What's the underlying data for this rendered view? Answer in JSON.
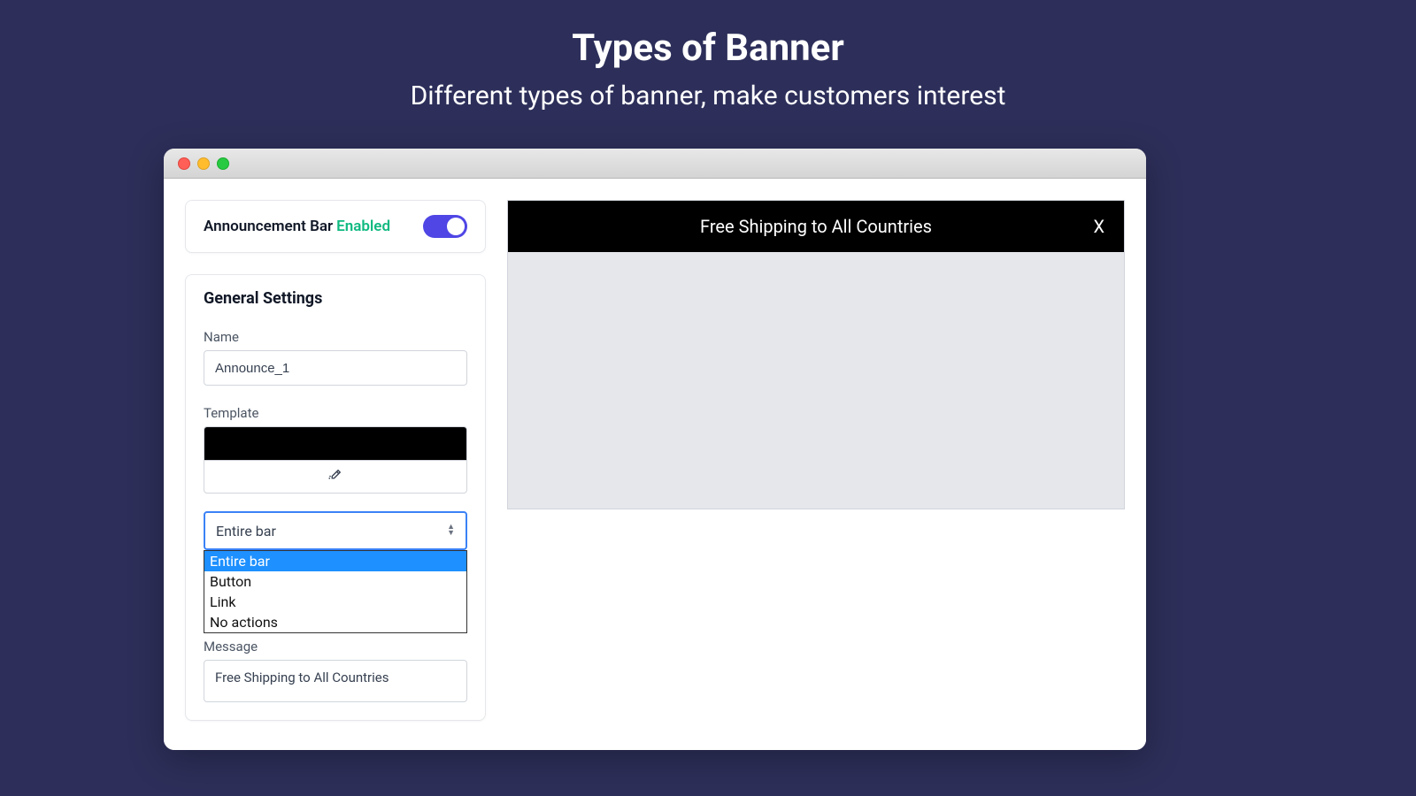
{
  "hero": {
    "title": "Types of Banner",
    "subtitle": "Different types of banner, make customers interest"
  },
  "enable_card": {
    "label": "Announcement Bar",
    "status": "Enabled"
  },
  "settings": {
    "title": "General Settings",
    "name_label": "Name",
    "name_value": "Announce_1",
    "template_label": "Template",
    "select_value": "Entire bar",
    "dropdown": {
      "opt0": "Entire bar",
      "opt1": "Button",
      "opt2": "Link",
      "opt3": "No actions"
    },
    "message_label": "Message",
    "message_value": "Free Shipping to All Countries"
  },
  "preview": {
    "banner_text": "Free Shipping to All Countries",
    "close": "X"
  }
}
